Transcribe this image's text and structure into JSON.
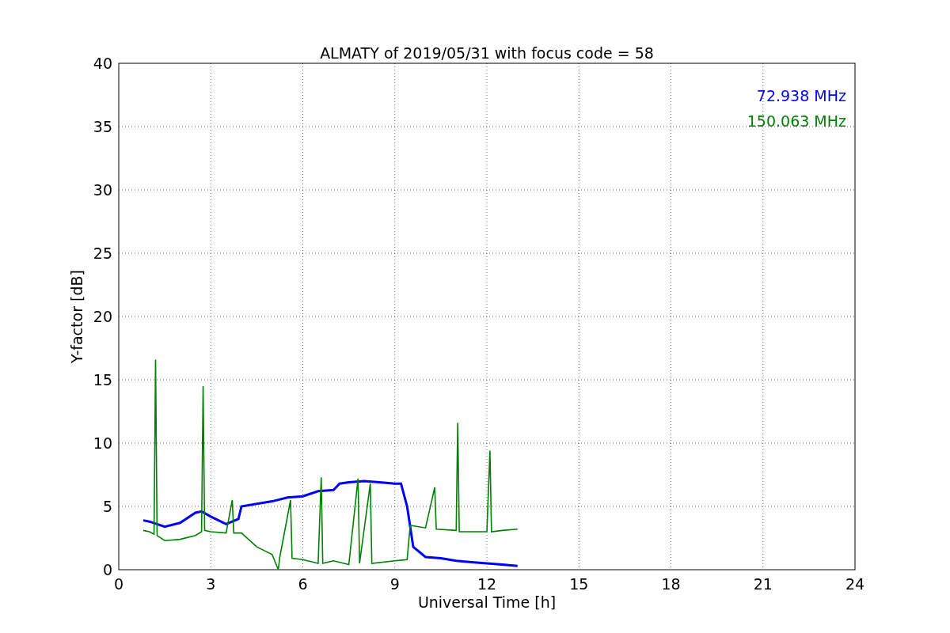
{
  "chart_data": {
    "type": "line",
    "grid": true,
    "title": "ALMATY of 2019/05/31 with focus code = 58",
    "xlabel": "Universal Time [h]",
    "ylabel": "Y-factor [dB]",
    "xlim": [
      0,
      24
    ],
    "ylim": [
      0,
      40
    ],
    "xticks": [
      0,
      3,
      6,
      9,
      12,
      15,
      18,
      21,
      24
    ],
    "yticks": [
      0,
      5,
      10,
      15,
      20,
      25,
      30,
      35,
      40
    ],
    "series": [
      {
        "name": "72.938 MHz",
        "color": "#0000ff",
        "x": [
          0.8,
          1.0,
          1.5,
          2.0,
          2.5,
          2.7,
          3.0,
          3.5,
          3.9,
          4.0,
          4.5,
          5.0,
          5.5,
          6.0,
          6.5,
          7.0,
          7.2,
          7.5,
          8.0,
          8.5,
          9.0,
          9.2,
          9.4,
          9.6,
          10.0,
          10.5,
          11.0,
          11.5,
          12.0,
          12.5,
          13.0
        ],
        "values": [
          3.9,
          3.8,
          3.4,
          3.7,
          4.5,
          4.6,
          4.2,
          3.6,
          4.0,
          5.0,
          5.2,
          5.4,
          5.7,
          5.8,
          6.2,
          6.3,
          6.8,
          6.9,
          7.0,
          6.9,
          6.8,
          6.8,
          5.0,
          1.8,
          1.0,
          0.9,
          0.7,
          0.6,
          0.5,
          0.4,
          0.3
        ]
      },
      {
        "name": "150.063 MHz",
        "color": "#008000",
        "x": [
          0.8,
          1.0,
          1.15,
          1.2,
          1.25,
          1.5,
          2.0,
          2.5,
          2.7,
          2.75,
          2.8,
          3.0,
          3.5,
          3.7,
          3.75,
          4.0,
          4.5,
          5.0,
          5.2,
          5.25,
          5.6,
          5.65,
          6.0,
          6.5,
          6.6,
          6.65,
          7.0,
          7.5,
          7.8,
          7.85,
          8.2,
          8.25,
          9.0,
          9.4,
          9.5,
          10.0,
          10.3,
          10.35,
          11.0,
          11.05,
          11.1,
          12.0,
          12.1,
          12.15,
          12.5,
          13.0
        ],
        "values": [
          3.1,
          3.0,
          2.8,
          16.6,
          2.7,
          2.3,
          2.4,
          2.7,
          3.0,
          14.5,
          3.1,
          3.0,
          2.9,
          5.5,
          2.9,
          2.9,
          1.8,
          1.2,
          0.0,
          1.0,
          5.5,
          0.9,
          0.8,
          0.5,
          7.3,
          0.5,
          0.7,
          0.4,
          7.2,
          0.5,
          6.8,
          0.5,
          0.7,
          0.8,
          3.5,
          3.3,
          6.5,
          3.2,
          3.1,
          11.6,
          3.0,
          3.0,
          9.4,
          3.0,
          3.1,
          3.2
        ]
      }
    ]
  }
}
